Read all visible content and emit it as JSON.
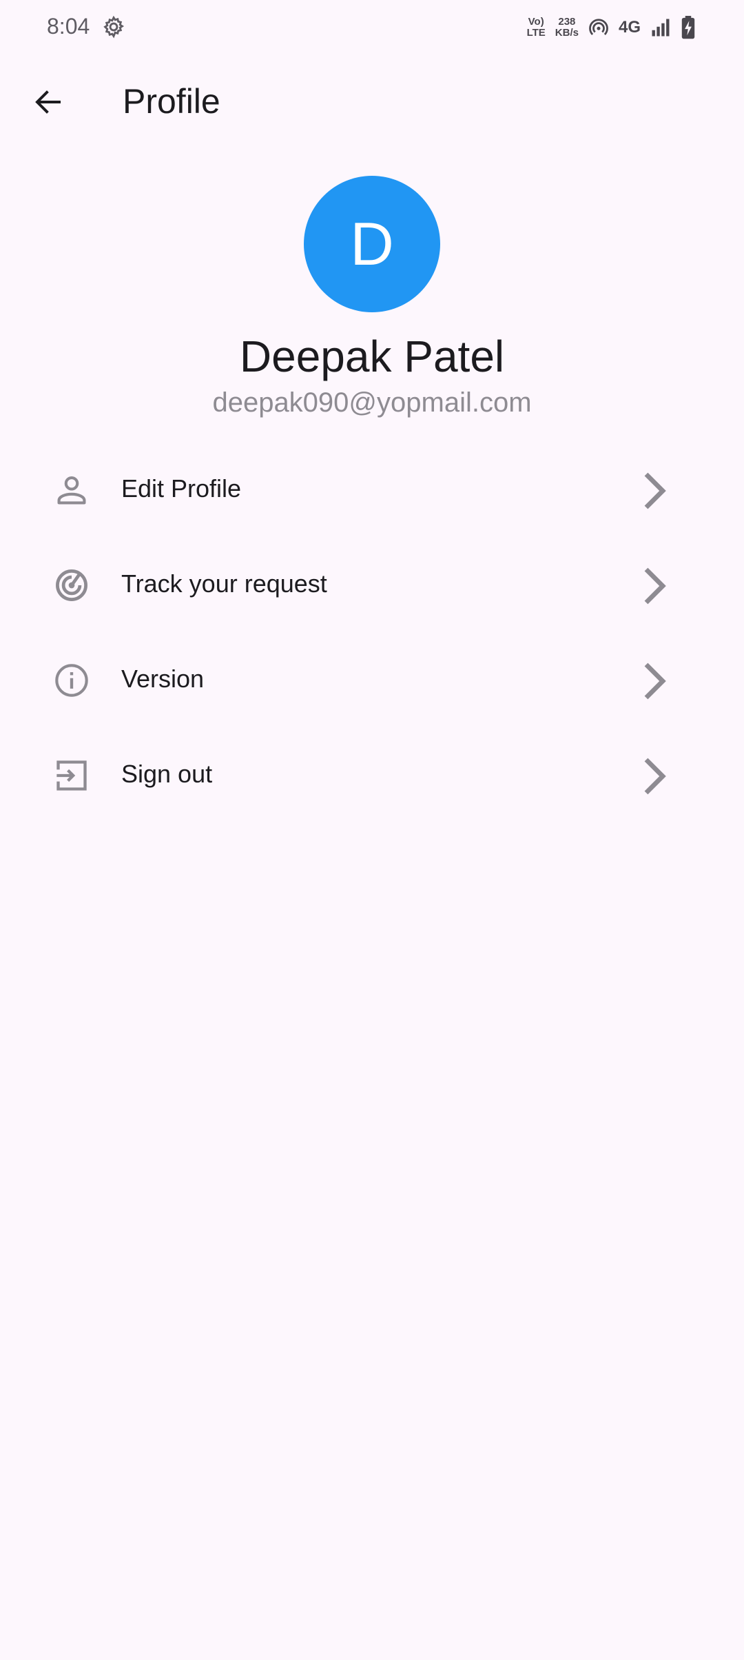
{
  "status_bar": {
    "time": "8:04",
    "volte_top": "Vo)",
    "volte_bottom": "LTE",
    "speed_value": "238",
    "speed_unit": "KB/s",
    "network": "4G"
  },
  "app_bar": {
    "title": "Profile"
  },
  "profile": {
    "avatar_letter": "D",
    "avatar_color": "#2196F3",
    "name": "Deepak Patel",
    "email": "deepak090@yopmail.com"
  },
  "menu": {
    "items": [
      {
        "label": "Edit Profile",
        "icon": "person-icon"
      },
      {
        "label": "Track your request",
        "icon": "track-icon"
      },
      {
        "label": "Version",
        "icon": "info-icon"
      },
      {
        "label": "Sign out",
        "icon": "sign-out-icon"
      }
    ]
  },
  "colors": {
    "background": "#FDF7FD",
    "icon_grey": "#8E8B92",
    "text": "#1C1B1F"
  }
}
